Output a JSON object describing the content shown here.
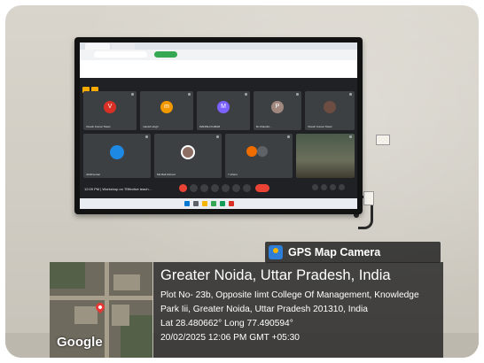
{
  "photo": {
    "tv_screen": {
      "meeting_info": "12:09 PM  |  Workshop on \"Effective teach...",
      "participants": [
        {
          "initial": "V",
          "color": "#d93025",
          "name": "Vinesh Kumar Tiwari"
        },
        {
          "initial": "m",
          "color": "#f29900",
          "name": "manish singh"
        },
        {
          "initial": "M",
          "color": "#7b61ff",
          "name": "MANISH KUMAR"
        },
        {
          "initial": "P",
          "color": "#a1887f",
          "name": "Dr.Chandni..."
        },
        {
          "initial": "",
          "color": "#6d4c41",
          "name": "Vinesh Kumar Tiwari"
        },
        {
          "initial": "",
          "color": "#1e88e5",
          "name": "nikhil kumar"
        },
        {
          "initial": "",
          "color": "#8d6e63",
          "name": "Md Rafi Ahmad"
        },
        {
          "initial": "",
          "color": "#ef6c00",
          "name": "7 others"
        },
        {
          "initial": "",
          "color": "#5d6d4e",
          "name": ""
        }
      ]
    },
    "badge": {
      "icon": "map-camera-icon",
      "label": "GPS Map Camera"
    },
    "map_logo": "Google",
    "location": {
      "title": "Greater Noida, Uttar Pradesh, India",
      "line1": "Plot No- 23b, Opposite Iimt College Of Management, Knowledge",
      "line2": "Park Iii, Greater Noida, Uttar Pradesh 201310, India",
      "coords": "Lat 28.480662° Long 77.490594°",
      "datetime": "20/02/2025 12:06 PM GMT +05:30"
    }
  }
}
